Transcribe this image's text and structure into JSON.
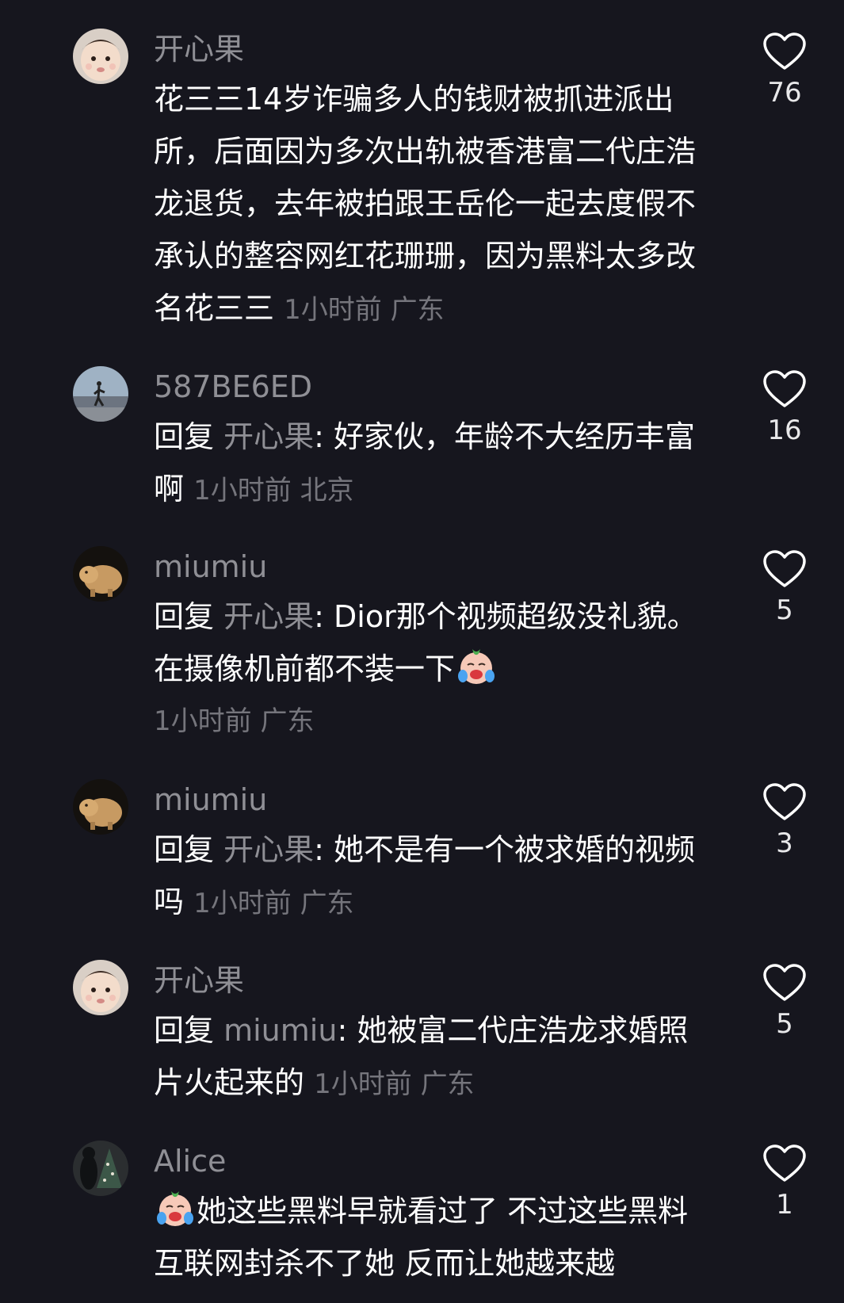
{
  "comments": [
    {
      "username": "开心果",
      "avatar_icon": "baby-face-avatar-icon",
      "text": "花三三14岁诈骗多人的钱财被抓进派出所，后面因为多次出轨被香港富二代庄浩龙退货，去年被拍跟王岳伦一起去度假不承认的整容网红花珊珊，因为黑料太多改名花三三",
      "time": "1小时前",
      "location": "广东",
      "likes": "76"
    },
    {
      "username": "587BE6ED",
      "avatar_icon": "beach-person-avatar-icon",
      "reply_prefix": "回复",
      "reply_to": "开心果",
      "text": "好家伙，年龄不大经历丰富啊",
      "time": "1小时前",
      "location": "北京",
      "likes": "16"
    },
    {
      "username": "miumiu",
      "avatar_icon": "capybara-avatar-icon",
      "reply_prefix": "回复",
      "reply_to": "开心果",
      "text": "Dior那个视频超级没礼貌。在摄像机前都不装一下",
      "emoji": "crying-face-emoji",
      "time": "1小时前",
      "location": "广东",
      "likes": "5"
    },
    {
      "username": "miumiu",
      "avatar_icon": "capybara-avatar-icon",
      "reply_prefix": "回复",
      "reply_to": "开心果",
      "text": "她不是有一个被求婚的视频吗",
      "time": "1小时前",
      "location": "广东",
      "likes": "3"
    },
    {
      "username": "开心果",
      "avatar_icon": "baby-face-avatar-icon",
      "reply_prefix": "回复",
      "reply_to": "miumiu",
      "text": "她被富二代庄浩龙求婚照片火起来的",
      "time": "1小时前",
      "location": "广东",
      "likes": "5"
    },
    {
      "username": "Alice",
      "avatar_icon": "christmas-tree-avatar-icon",
      "emoji": "crying-face-emoji",
      "text": "她这些黑料早就看过了 不过这些黑料互联网封杀不了她 反而让她越来越",
      "likes": "1"
    }
  ],
  "colors": {
    "background": "#16161e",
    "username": "#8f8f95",
    "meta": "#75757c",
    "text": "#ffffff"
  }
}
